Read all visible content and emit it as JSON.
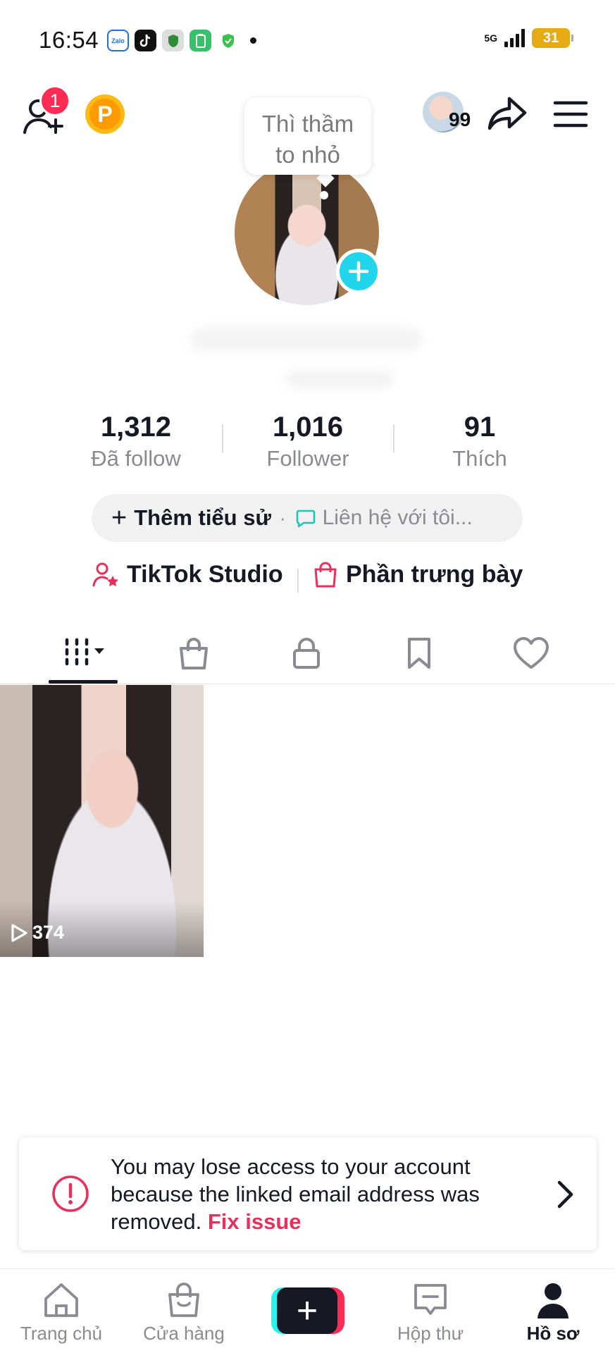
{
  "status_bar": {
    "time": "16:54",
    "network": "5G",
    "battery": "31",
    "apps": [
      "Zalo"
    ]
  },
  "top_bar": {
    "notification_count": "1",
    "points_label": "P",
    "story_count": "99"
  },
  "profile": {
    "note": "Thì thầm to nhỏ"
  },
  "stats": [
    {
      "value": "1,312",
      "label": "Đã follow"
    },
    {
      "value": "1,016",
      "label": "Follower"
    },
    {
      "value": "91",
      "label": "Thích"
    }
  ],
  "bio": {
    "plus": "+",
    "add_bio_label": "Thêm tiểu sử",
    "separator": "·",
    "contact_placeholder": "Liên hệ với tôi..."
  },
  "links": {
    "studio": "TikTok Studio",
    "showcase": "Phần trưng bày"
  },
  "tabs": [
    "videos-grid",
    "shop",
    "private",
    "favorites",
    "liked"
  ],
  "videos": [
    {
      "views": "374"
    }
  ],
  "warning": {
    "message": "You may lose access to your account because the linked email address was removed.",
    "action": "Fix issue"
  },
  "bottom_nav": [
    {
      "label": "Trang chủ"
    },
    {
      "label": "Cửa hàng"
    },
    {
      "label": "+"
    },
    {
      "label": "Hộp thư"
    },
    {
      "label": "Hồ sơ"
    }
  ],
  "colors": {
    "accent_cyan": "#20d5ec",
    "accent_red": "#fe2c55",
    "link_red": "#e8305d",
    "text_primary": "#161823",
    "text_secondary": "#8a8b91",
    "coin": "#ff9a00",
    "battery": "#e6aa12"
  }
}
